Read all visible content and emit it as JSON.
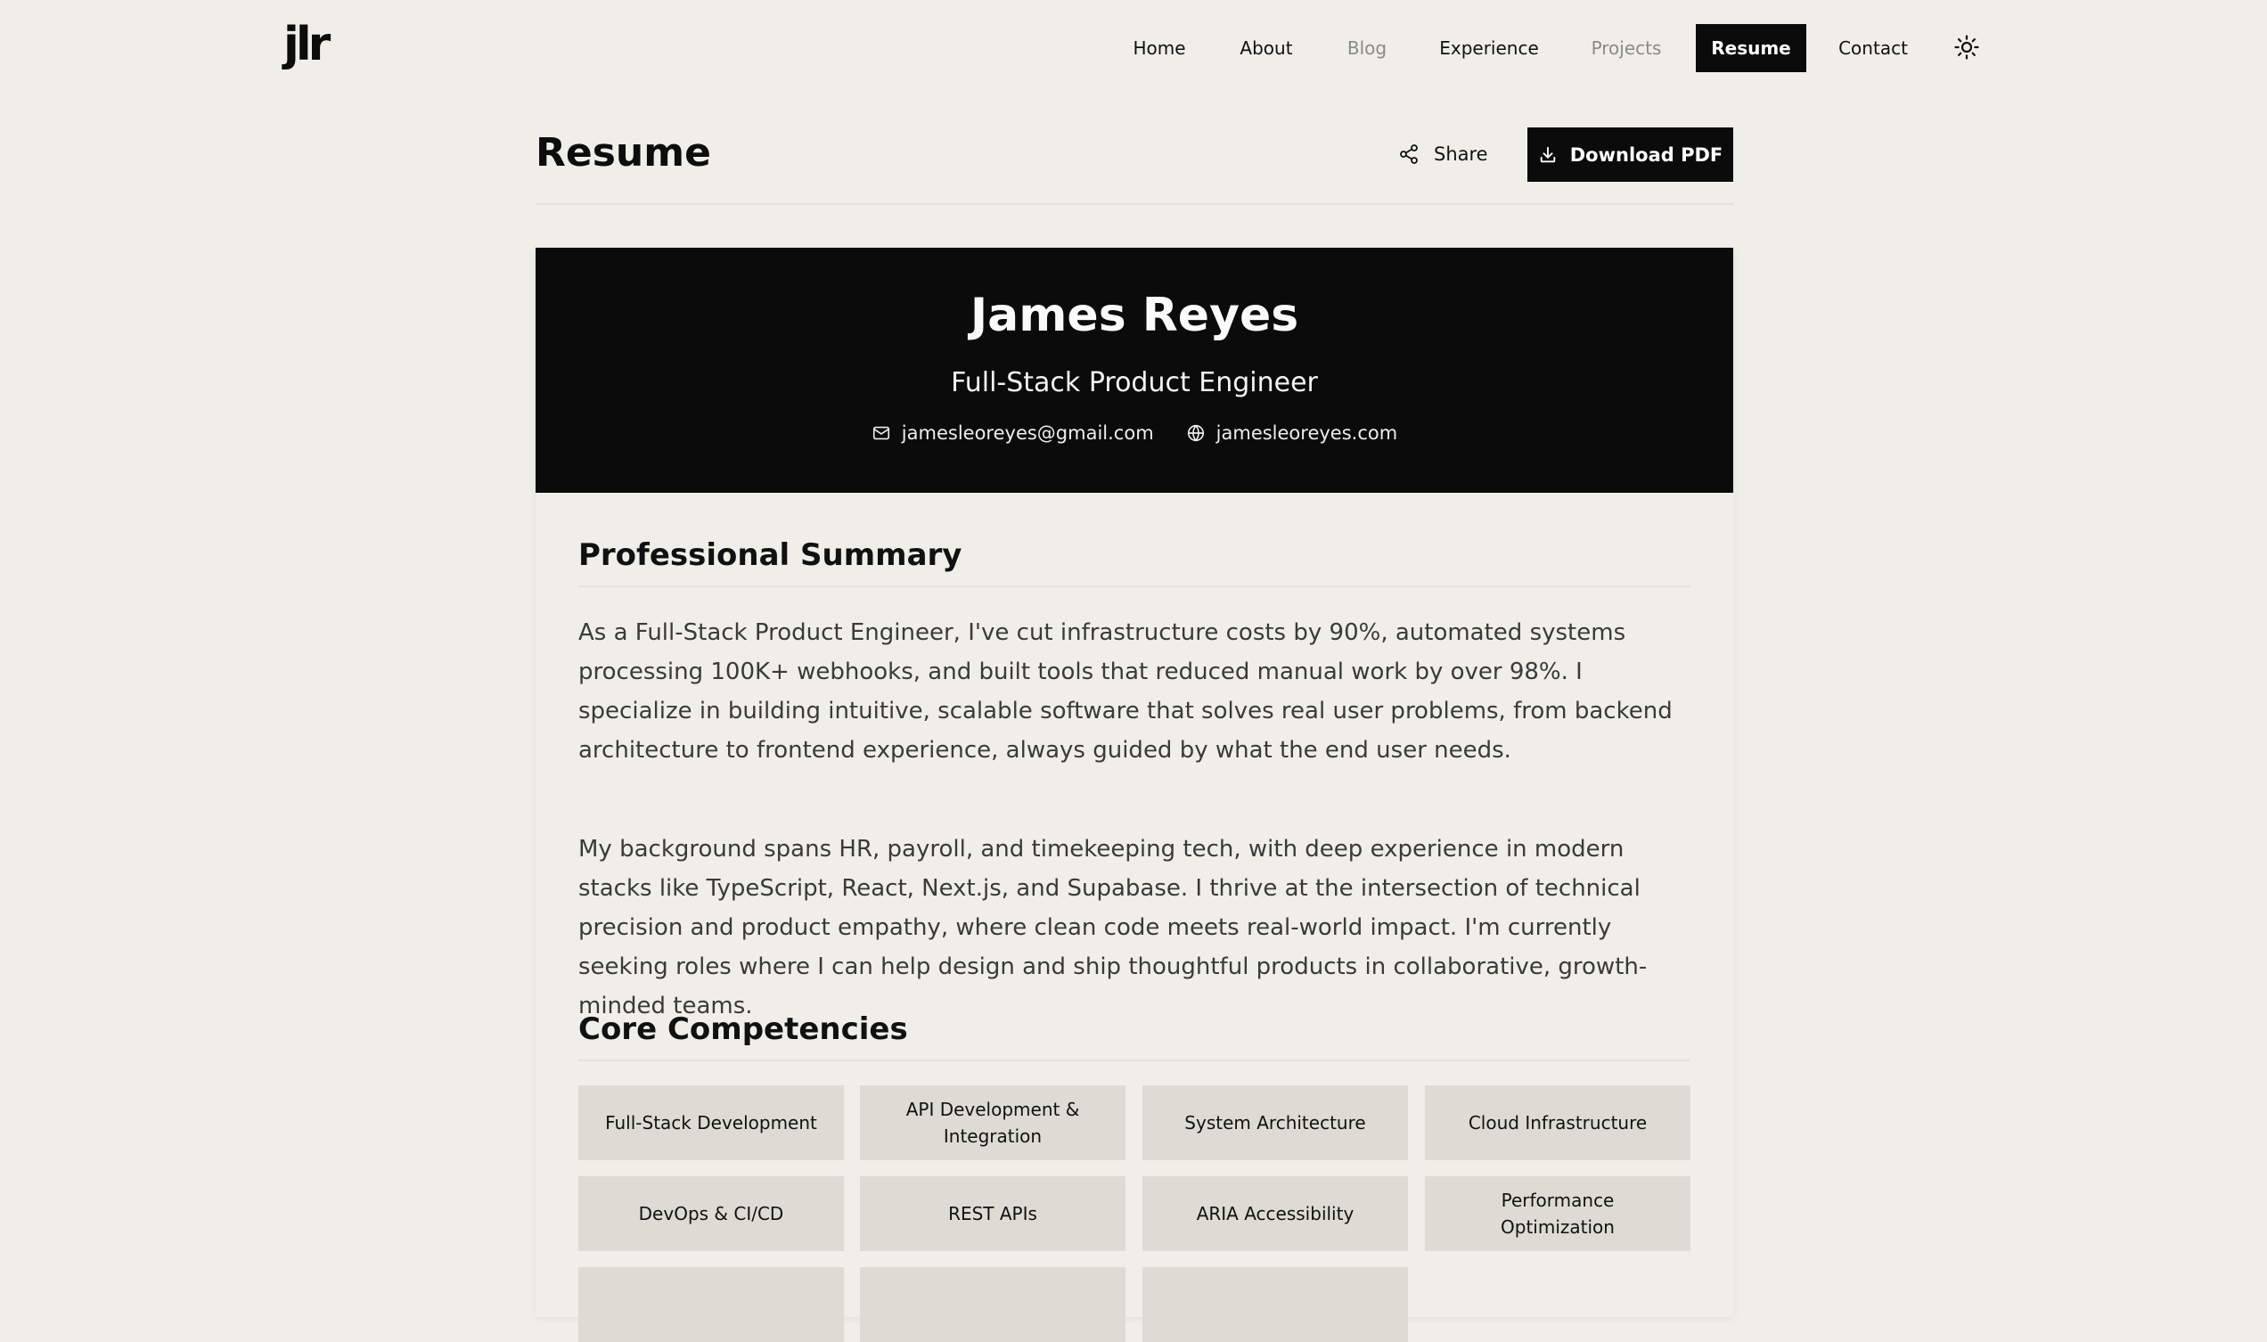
{
  "logo": "jlr",
  "nav": {
    "items": [
      {
        "label": "Home"
      },
      {
        "label": "About"
      },
      {
        "label": "Blog"
      },
      {
        "label": "Experience"
      },
      {
        "label": "Projects"
      },
      {
        "label": "Resume"
      },
      {
        "label": "Contact"
      }
    ],
    "active": "Resume",
    "theme_icon": "sun-icon"
  },
  "page": {
    "title": "Resume",
    "share_label": "Share",
    "download_label": "Download PDF"
  },
  "resume": {
    "name": "James Reyes",
    "role": "Full-Stack Product Engineer",
    "email": "jamesleoreyes@gmail.com",
    "website": "jamesleoreyes.com",
    "summary_title": "Professional Summary",
    "summary": [
      "As a Full-Stack Product Engineer, I've cut infrastructure costs by 90%, automated systems processing 100K+ webhooks, and built tools that reduced manual work by over 98%. I specialize in building intuitive, scalable software that solves real user problems, from backend architecture to frontend experience, always guided by what the end user needs.",
      "My background spans HR, payroll, and timekeeping tech, with deep experience in modern stacks like TypeScript, React, Next.js, and Supabase. I thrive at the intersection of technical precision and product empathy, where clean code meets real-world impact. I'm currently seeking roles where I can help design and ship thoughtful products in collaborative, growth-minded teams."
    ],
    "competencies_title": "Core Competencies",
    "competencies": [
      "Full-Stack Development",
      "API Development & Integration",
      "System Architecture",
      "Cloud Infrastructure",
      "DevOps & CI/CD",
      "REST APIs",
      "ARIA Accessibility",
      "Performance Optimization"
    ]
  },
  "colors": {
    "background": "#efeee8",
    "dark": "#0b0b0b",
    "chip": "#dcdbd4",
    "muted_nav": "#8a8a86"
  }
}
